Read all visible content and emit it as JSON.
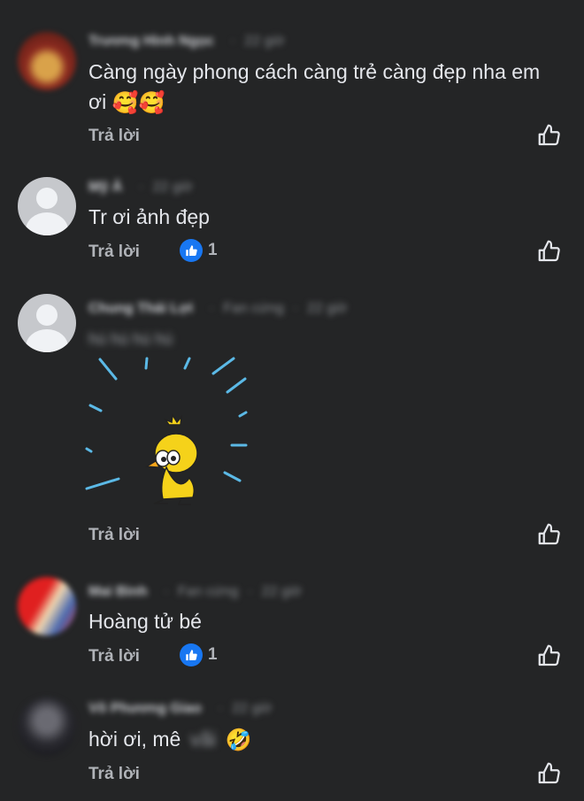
{
  "reply_label": "Trả lời",
  "comments": [
    {
      "name": "Trương Hình Ngọc",
      "time": "22 giờ",
      "text": "Càng ngày phong cách càng trẻ càng đẹp nha em ơi",
      "emoji": "🥰🥰",
      "reaction_count": null
    },
    {
      "name": "Mỹ Ả",
      "time": "22 giờ",
      "text": "Tr ơi ảnh đẹp",
      "reaction_count": "1"
    },
    {
      "name": "Chung Thái Lợi",
      "badge": "Fan cứng",
      "time": "22 giờ",
      "text": "hú hú hú hú",
      "sticker": "woodstock-sticker",
      "reaction_count": null
    },
    {
      "name": "Mai Bình",
      "badge": "Fan cứng",
      "time": "22 giờ",
      "text": "Hoàng tử bé",
      "reaction_count": "1"
    },
    {
      "name": "Võ Phương Giao",
      "time": "22 giờ",
      "text": "hời ơi, mê",
      "text_blurred": "vãi",
      "emoji": "🤣",
      "reaction_count": null
    }
  ],
  "icons": {
    "like": "thumbs-up-icon",
    "reaction": "like-reaction-icon"
  },
  "colors": {
    "background": "#242526",
    "text": "#e4e6eb",
    "muted": "#b0b3b8",
    "like_blue": "#1877f2",
    "sticker_yellow": "#f5d21a",
    "sticker_lines": "#5bb9e6"
  }
}
